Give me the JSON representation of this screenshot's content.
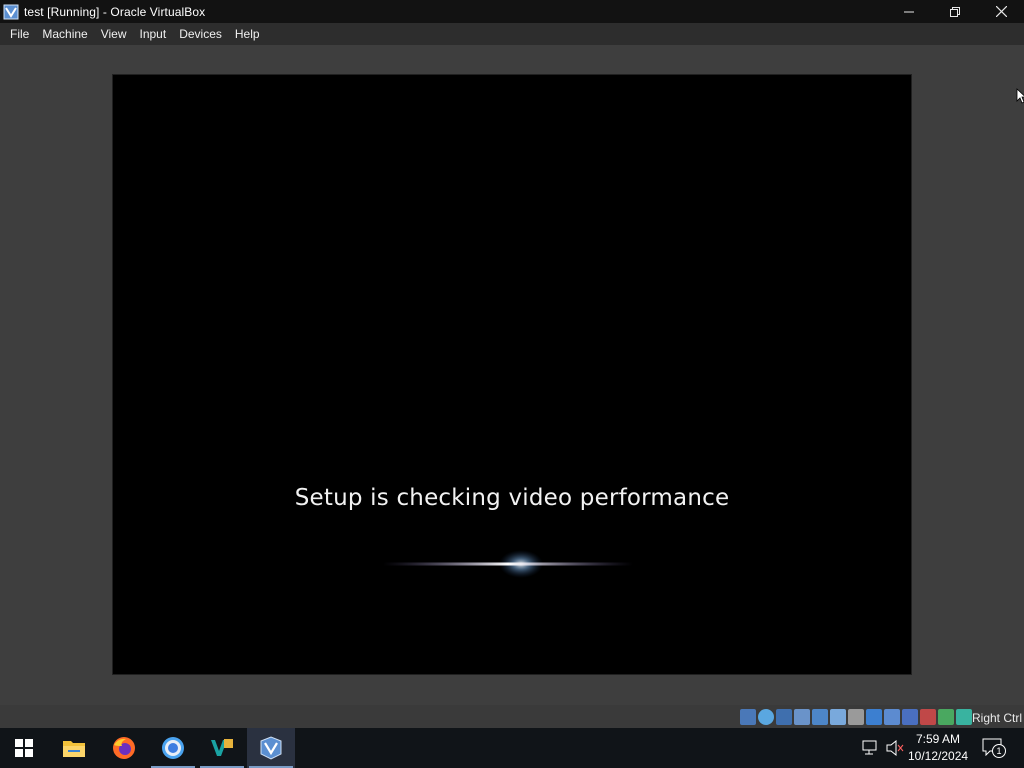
{
  "window": {
    "title": "test [Running] - Oracle VirtualBox",
    "icon": "virtualbox-icon",
    "controls": [
      "minimize-icon",
      "restore-icon",
      "close-icon"
    ]
  },
  "menu": {
    "items": [
      "File",
      "Machine",
      "View",
      "Input",
      "Devices",
      "Help"
    ]
  },
  "vm": {
    "message": "Setup is checking video performance"
  },
  "statusbar": {
    "icons": [
      "hard-disk-icon",
      "optical-drive-icon",
      "floppy-icon",
      "audio-icon",
      "network-icon",
      "usb-icon",
      "shared-folders-icon",
      "display-icon",
      "video-capture-icon",
      "virtualization-icon",
      "guest-additions-icon",
      "mouse-integration-icon",
      "keyboard-capture-icon"
    ],
    "host_key": "Right Ctrl"
  },
  "taskbar": {
    "apps": [
      "windows-start-icon",
      "file-explorer-icon",
      "firefox-icon",
      "chrome-icon",
      "vs-icon",
      "virtualbox-icon"
    ],
    "tray": {
      "time": "7:59 AM",
      "date": "10/12/2024",
      "notification_count": "1"
    }
  },
  "colors": {
    "titlebar": "#121212",
    "menubar": "#2d2d2d",
    "background": "#3e3e3e",
    "taskbar": "#101418",
    "vm_screen": "#000000"
  }
}
